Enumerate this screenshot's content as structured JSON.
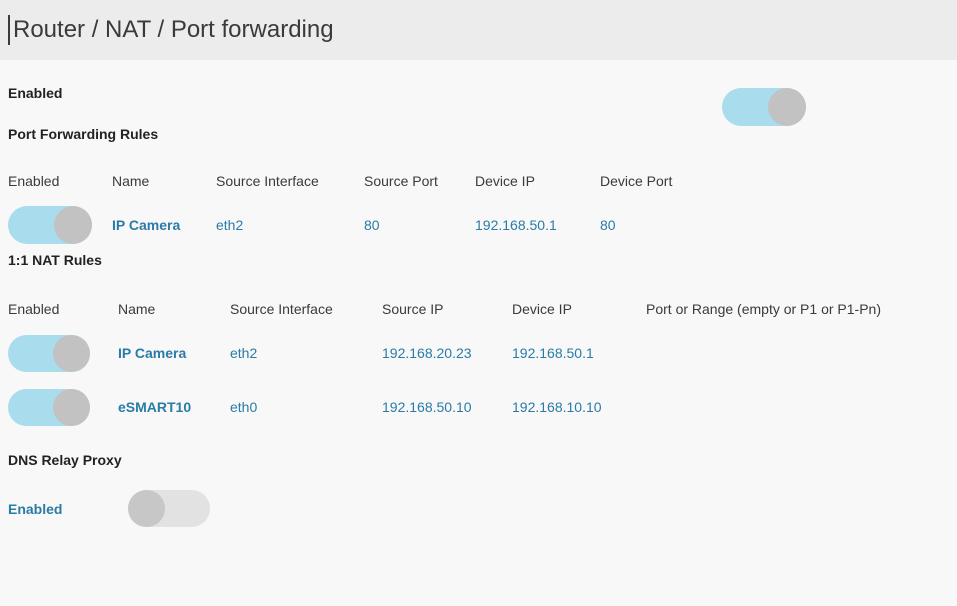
{
  "header": {
    "title": "Router / NAT / Port forwarding",
    "caret": "text-cursor"
  },
  "colors": {
    "header_background": "#ececec",
    "page_background": "#f8f8f8",
    "link_blue": "#2a7ba6",
    "toggle_on_track": "#a9dcec",
    "toggle_on_knob": "#c2c2c2",
    "toggle_off_track": "#e2e2e2",
    "toggle_off_knob": "#c7c7c7",
    "heading_text": "#222222"
  },
  "enabled_section": {
    "label": "Enabled",
    "toggle_state": "on"
  },
  "port_forwarding": {
    "heading": "Port Forwarding Rules",
    "columns": [
      "Enabled",
      "Name",
      "Source Interface",
      "Source Port",
      "Device IP",
      "Device Port"
    ],
    "rows": [
      {
        "enabled": "on",
        "name": "IP Camera",
        "source_interface": "eth2",
        "source_port": "80",
        "device_ip": "192.168.50.1",
        "device_port": "80"
      }
    ]
  },
  "nat_rules": {
    "heading": "1:1 NAT Rules",
    "columns": [
      "Enabled",
      "Name",
      "Source Interface",
      "Source IP",
      "Device IP",
      "Port or Range (empty or P1 or P1-Pn)"
    ],
    "rows": [
      {
        "enabled": "on",
        "name": "IP Camera",
        "source_interface": "eth2",
        "source_ip": "192.168.20.23",
        "device_ip": "192.168.50.1",
        "port_or_range": ""
      },
      {
        "enabled": "on",
        "name": "eSMART10",
        "source_interface": "eth0",
        "source_ip": "192.168.50.10",
        "device_ip": "192.168.10.10",
        "port_or_range": ""
      }
    ]
  },
  "dns_relay_proxy": {
    "heading": "DNS Relay Proxy",
    "label": "Enabled",
    "toggle_state": "off"
  }
}
